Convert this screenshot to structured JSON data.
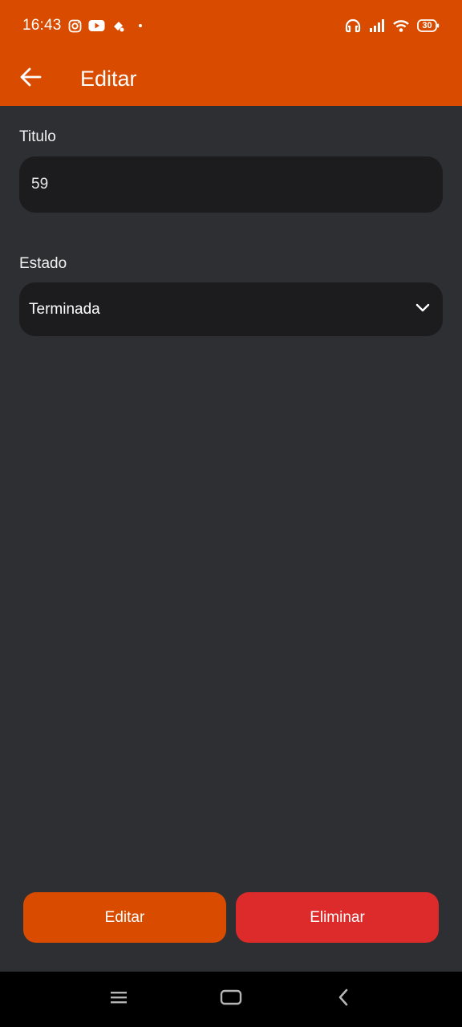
{
  "status_bar": {
    "time": "16:43",
    "battery": "30",
    "icons": [
      "instagram-icon",
      "youtube-icon",
      "notification-icon",
      "dot-icon",
      "headset-icon",
      "signal-icon",
      "wifi-icon",
      "battery-icon"
    ]
  },
  "app_bar": {
    "title": "Editar",
    "back_icon": "arrow-left-icon"
  },
  "form": {
    "title_label": "Titulo",
    "title_value": "59",
    "state_label": "Estado",
    "state_value": "Terminada",
    "dropdown_icon": "chevron-down-icon"
  },
  "actions": {
    "edit_label": "Editar",
    "delete_label": "Eliminar"
  },
  "nav_bar": {
    "icons": [
      "menu-icon",
      "home-icon",
      "back-icon"
    ]
  },
  "colors": {
    "primary": "#d94c00",
    "danger": "#dc2b2a",
    "background": "#2e2f33",
    "field": "#1c1c1e"
  }
}
